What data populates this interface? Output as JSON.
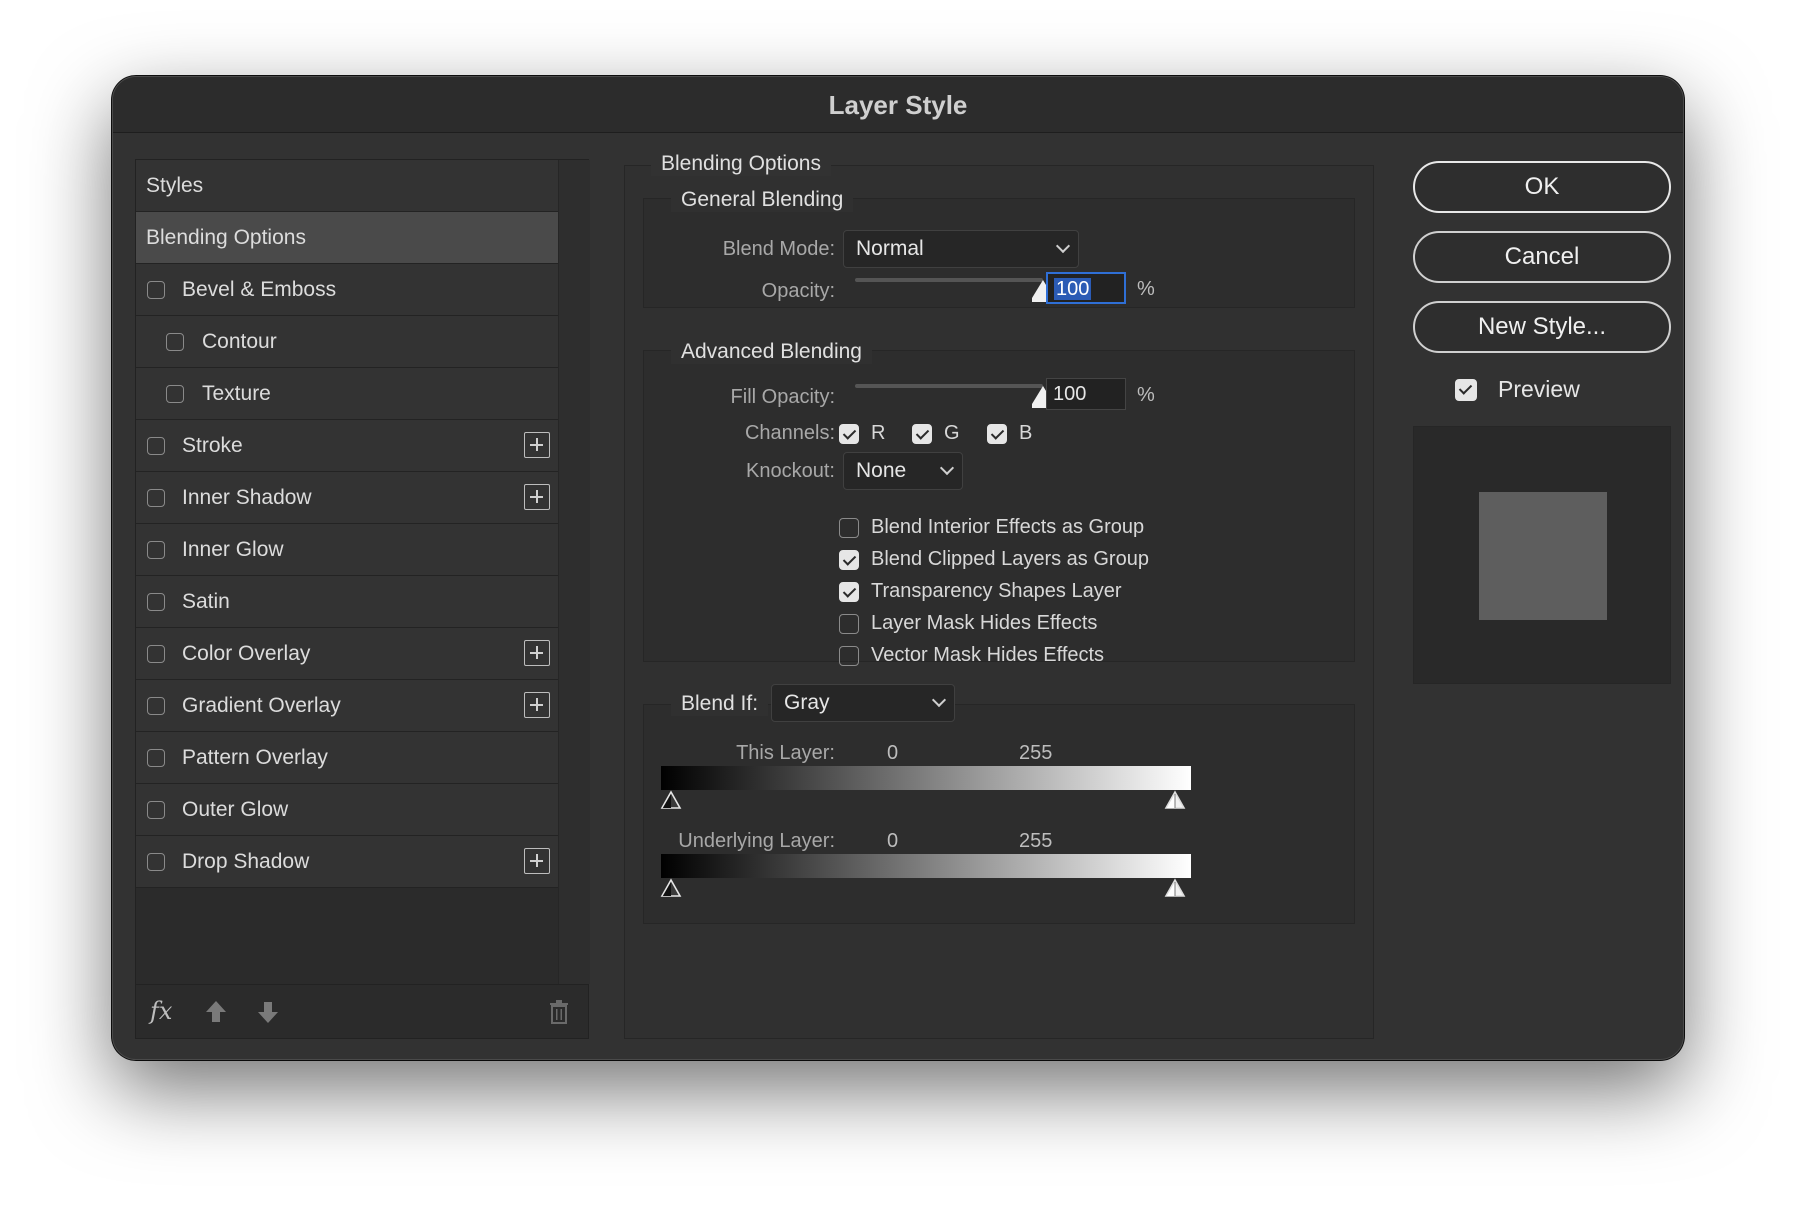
{
  "window": {
    "title": "Layer Style"
  },
  "styles_panel": {
    "header": "Styles",
    "selected": "Blending Options",
    "items": [
      {
        "label": "Bevel & Emboss",
        "checked": false,
        "indent": false,
        "has_add": false
      },
      {
        "label": "Contour",
        "checked": false,
        "indent": true,
        "has_add": false
      },
      {
        "label": "Texture",
        "checked": false,
        "indent": true,
        "has_add": false
      },
      {
        "label": "Stroke",
        "checked": false,
        "indent": false,
        "has_add": true
      },
      {
        "label": "Inner Shadow",
        "checked": false,
        "indent": false,
        "has_add": true
      },
      {
        "label": "Inner Glow",
        "checked": false,
        "indent": false,
        "has_add": false
      },
      {
        "label": "Satin",
        "checked": false,
        "indent": false,
        "has_add": false
      },
      {
        "label": "Color Overlay",
        "checked": false,
        "indent": false,
        "has_add": true
      },
      {
        "label": "Gradient Overlay",
        "checked": false,
        "indent": false,
        "has_add": true
      },
      {
        "label": "Pattern Overlay",
        "checked": false,
        "indent": false,
        "has_add": false
      },
      {
        "label": "Outer Glow",
        "checked": false,
        "indent": false,
        "has_add": false
      },
      {
        "label": "Drop Shadow",
        "checked": false,
        "indent": false,
        "has_add": true
      }
    ],
    "footer": {
      "fx_label": "fx"
    }
  },
  "blending": {
    "title": "Blending Options",
    "general": {
      "title": "General Blending",
      "blend_mode_label": "Blend Mode:",
      "blend_mode_value": "Normal",
      "opacity_label": "Opacity:",
      "opacity_value": "100",
      "opacity_unit": "%",
      "opacity_fraction": 1.0
    },
    "advanced": {
      "title": "Advanced Blending",
      "fill_opacity_label": "Fill Opacity:",
      "fill_opacity_value": "100",
      "fill_opacity_unit": "%",
      "fill_opacity_fraction": 1.0,
      "channels_label": "Channels:",
      "channels": [
        {
          "label": "R",
          "checked": true
        },
        {
          "label": "G",
          "checked": true
        },
        {
          "label": "B",
          "checked": true
        }
      ],
      "knockout_label": "Knockout:",
      "knockout_value": "None",
      "options": [
        {
          "label": "Blend Interior Effects as Group",
          "checked": false
        },
        {
          "label": "Blend Clipped Layers as Group",
          "checked": true
        },
        {
          "label": "Transparency Shapes Layer",
          "checked": true
        },
        {
          "label": "Layer Mask Hides Effects",
          "checked": false
        },
        {
          "label": "Vector Mask Hides Effects",
          "checked": false
        }
      ]
    },
    "blend_if": {
      "label": "Blend If:",
      "value": "Gray",
      "this_layer": {
        "label": "This Layer:",
        "low": "0",
        "high": "255"
      },
      "underlying_layer": {
        "label": "Underlying Layer:",
        "low": "0",
        "high": "255"
      }
    }
  },
  "actions": {
    "ok": "OK",
    "cancel": "Cancel",
    "new_style": "New Style...",
    "preview_label": "Preview",
    "preview_checked": true
  },
  "colors": {
    "window_bg": "#323232",
    "selection_blue": "#2b5bb5",
    "preview_swatch": "#5e5e5e"
  }
}
